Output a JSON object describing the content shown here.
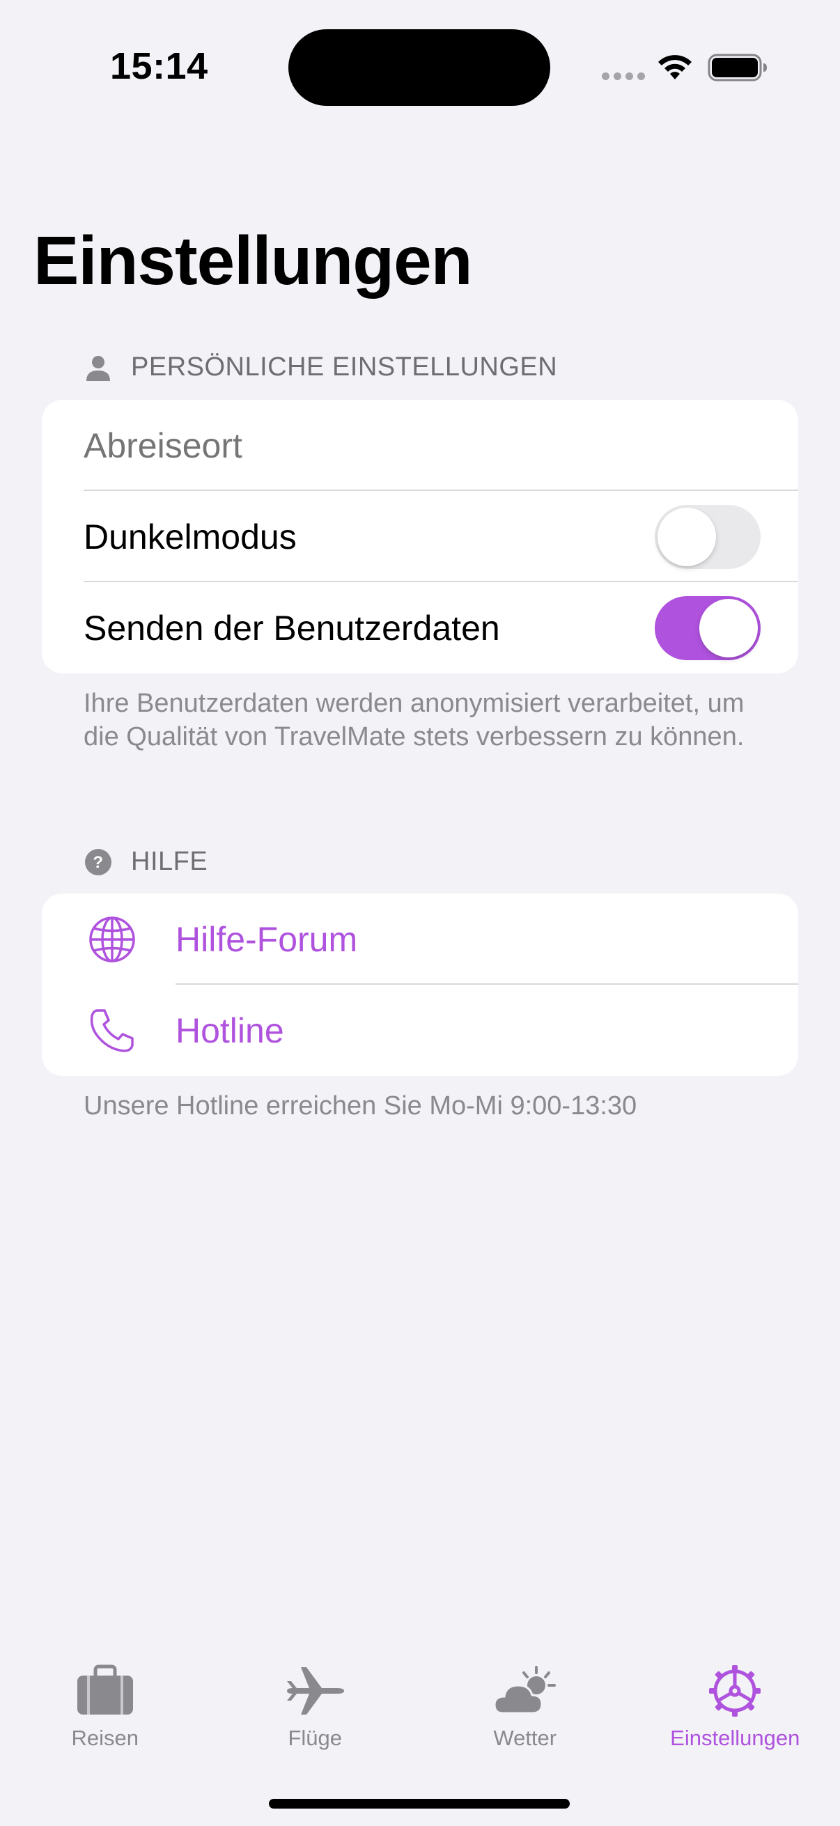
{
  "status_bar": {
    "time": "15:14"
  },
  "page": {
    "title": "Einstellungen"
  },
  "personal_section": {
    "header": "PERSÖNLICHE EINSTELLUNGEN",
    "header_icon": "person-icon",
    "departure_placeholder": "Abreiseort",
    "dark_mode_label": "Dunkelmodus",
    "dark_mode_on": false,
    "send_data_label": "Senden der Benutzerdaten",
    "send_data_on": true,
    "footer": "Ihre Benutzerdaten werden anonymisiert verarbeitet, um die Qualität von TravelMate stets verbessern zu können."
  },
  "help_section": {
    "header": "HILFE",
    "header_icon": "question-circle-icon",
    "items": [
      {
        "label": "Hilfe-Forum",
        "icon": "globe-icon"
      },
      {
        "label": "Hotline",
        "icon": "phone-icon"
      }
    ],
    "footer": "Unsere Hotline erreichen Sie Mo-Mi 9:00-13:30"
  },
  "tab_bar": {
    "tabs": [
      {
        "label": "Reisen",
        "icon": "suitcase-icon",
        "active": false
      },
      {
        "label": "Flüge",
        "icon": "airplane-icon",
        "active": false
      },
      {
        "label": "Wetter",
        "icon": "cloud-sun-icon",
        "active": false
      },
      {
        "label": "Einstellungen",
        "icon": "gear-icon",
        "active": true
      }
    ]
  },
  "colors": {
    "accent": "#af52de",
    "background": "#f2f2f7",
    "secondary_text": "#8a8a8e"
  }
}
